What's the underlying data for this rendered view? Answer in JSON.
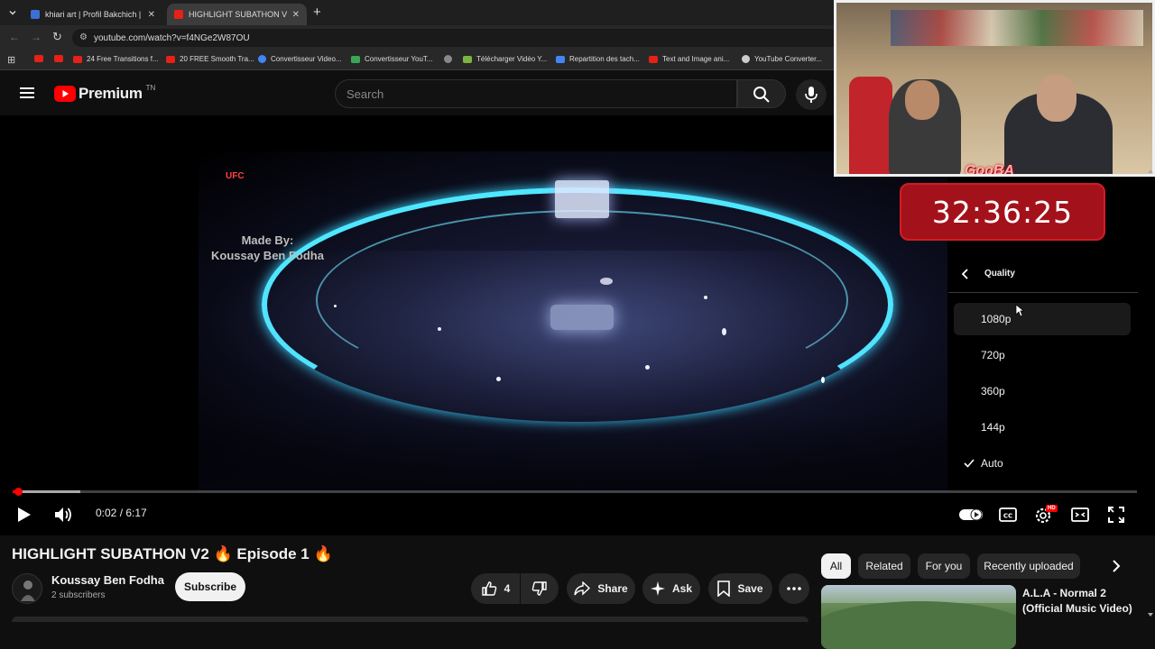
{
  "browser": {
    "tabs": [
      {
        "label": "khiari art | Profil Bakchich | Bak",
        "active": false
      },
      {
        "label": "HIGHLIGHT SUBATHON V2 🔥",
        "active": true
      }
    ],
    "new_tab_symbol": "+",
    "url": "youtube.com/watch?v=f4NGe2W87OU",
    "bookmarks": [
      {
        "label": "",
        "color": "#e62117"
      },
      {
        "label": "",
        "color": "#e62117"
      },
      {
        "label": "24 Free Transitions f...",
        "color": "#e62117"
      },
      {
        "label": "20 FREE Smooth Tra...",
        "color": "#e62117"
      },
      {
        "label": "Convertisseur Video...",
        "color": "#4285f4"
      },
      {
        "label": "Convertisseur YouT...",
        "color": "#3aa757"
      },
      {
        "label": "",
        "color": "#888888"
      },
      {
        "label": "Télécharger Vidéo Y...",
        "color": "#7cb342"
      },
      {
        "label": "Repartition des tach...",
        "color": "#4285f4"
      },
      {
        "label": "Text and Image ani...",
        "color": "#e62117"
      },
      {
        "label": "YouTube Converter...",
        "color": "#cccccc"
      }
    ]
  },
  "header": {
    "logo_text": "Premium",
    "country_code": "TN",
    "search_placeholder": "Search"
  },
  "video": {
    "overlay_text_line1": "Made By:",
    "overlay_text_line2": "Koussay Ben Fodha",
    "arena_logo": "UFC",
    "webcam_name": "GooBA",
    "timer": "32:36:25"
  },
  "quality_menu": {
    "title": "Quality",
    "options": [
      "1080p",
      "720p",
      "360p",
      "144p",
      "Auto"
    ],
    "selected": "Auto",
    "hovered": "1080p"
  },
  "controls": {
    "current_time": "0:02",
    "duration": "6:17",
    "time_separator": " / ",
    "progress_fraction": 0.005,
    "buffered_fraction": 0.06,
    "hd_badge": "HD"
  },
  "info": {
    "title": "HIGHLIGHT SUBATHON V2 🔥 Episode 1 🔥",
    "channel_name": "Koussay Ben Fodha",
    "subscribers": "2 subscribers",
    "subscribe_label": "Subscribe",
    "like_count": "4",
    "share_label": "Share",
    "ask_label": "Ask",
    "save_label": "Save"
  },
  "sidebar": {
    "chips": [
      "All",
      "Related",
      "For you",
      "Recently uploaded"
    ],
    "active_chip": "All",
    "related": [
      {
        "title_line1": "A.L.A - Normal 2",
        "title_line2": "(Official Music Video)"
      }
    ]
  },
  "colors": {
    "accent_red": "#ff0000",
    "background": "#0f0f0f",
    "timer_red": "#a3121a"
  }
}
